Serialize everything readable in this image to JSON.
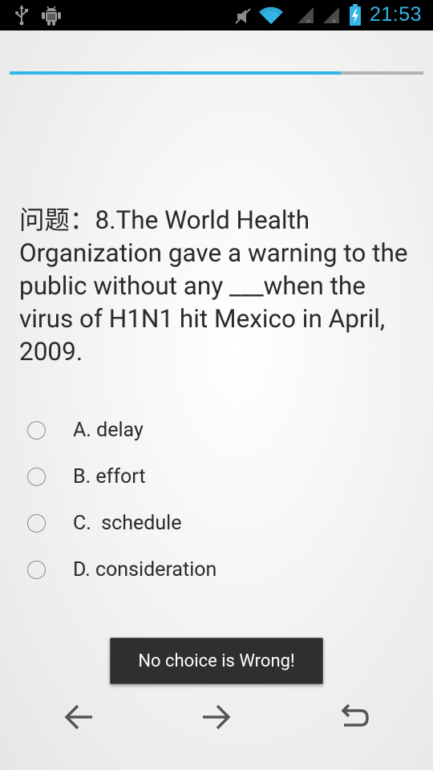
{
  "status_bar": {
    "time": "21:53",
    "icons": [
      "usb-icon",
      "android-debug-icon",
      "mute-icon",
      "wifi-icon",
      "signal-icon",
      "signal-icon",
      "battery-charging-icon"
    ]
  },
  "quiz": {
    "progress": 0.8,
    "question": "问题：8.The World Health Organization gave a warning to the public without any ___when the virus of H1N1 hit Mexico in April, 2009.",
    "options": [
      {
        "label": "A. delay",
        "selected": false
      },
      {
        "label": "B. effort",
        "selected": false
      },
      {
        "label": "C.  schedule",
        "selected": false
      },
      {
        "label": "D. consideration",
        "selected": false
      }
    ]
  },
  "toast": {
    "message": "No choice is Wrong!"
  },
  "nav": {
    "icons": [
      "arrow-left-icon",
      "arrow-right-icon",
      "undo-icon"
    ]
  },
  "colors": {
    "accent": "#33b5e5",
    "status_bar_bg": "#000000",
    "text": "#2a2a2a",
    "toast_bg": "#2f2f2f"
  }
}
